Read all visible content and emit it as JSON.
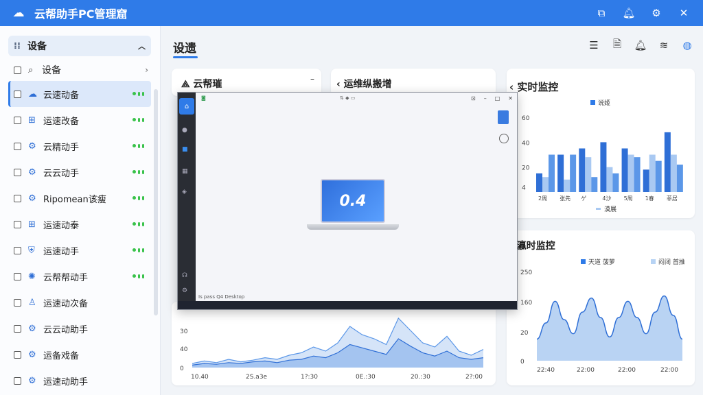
{
  "app": {
    "title": "云帮助手PC管理窟",
    "logo_icon": "cloud-logo-icon"
  },
  "titlebar_icons": [
    "screen-share-icon",
    "bell-icon",
    "gear-icon",
    "close-icon"
  ],
  "sidebar": {
    "header": "设备",
    "search": "设备",
    "items": [
      {
        "label": "云速动备",
        "icon": "cloud-icon",
        "active": true
      },
      {
        "label": "运速改备",
        "icon": "windows-icon"
      },
      {
        "label": "云精动手",
        "icon": "gear-icon"
      },
      {
        "label": "云云动手",
        "icon": "gear-icon"
      },
      {
        "label": "Ripomean该瘦",
        "icon": "gear-icon"
      },
      {
        "label": "运速动泰",
        "icon": "windows-icon"
      },
      {
        "label": "运速动手",
        "icon": "shield-icon"
      },
      {
        "label": "云帮帮动手",
        "icon": "settings-icon"
      },
      {
        "label": "运速动次备",
        "icon": "user-icon"
      },
      {
        "label": "云云动助手",
        "icon": "gear-icon"
      },
      {
        "label": "运备戏备",
        "icon": "gear-icon"
      },
      {
        "label": "运速动助手",
        "icon": "gear-icon"
      }
    ]
  },
  "main": {
    "title": "设遗",
    "tools": [
      "menu-icon",
      "document-icon",
      "bell-icon",
      "layers-icon",
      "globe-icon"
    ]
  },
  "cards": {
    "card1_title": "云帮璀",
    "card2_title": "运维纵搬增",
    "realtime_title": "实时监控",
    "realtime2_title": "瀛时监控"
  },
  "remote": {
    "status": "Is pass Q4 Desktop",
    "screen_text": "0.4"
  },
  "chart_data": [
    {
      "type": "bar",
      "title": "实时监控",
      "legend": [
        "说姬"
      ],
      "categories": [
        "2周",
        "张先",
        "ゲ",
        "4沙",
        "5周",
        "1春",
        "菲居"
      ],
      "yticks": [
        4,
        20,
        40,
        60
      ],
      "series": [
        {
          "values": [
            15,
            30,
            35,
            40,
            35,
            18,
            48
          ]
        },
        {
          "values": [
            12,
            10,
            28,
            20,
            30,
            30,
            30
          ]
        },
        {
          "values": [
            30,
            30,
            12,
            15,
            28,
            25,
            22
          ]
        }
      ],
      "bottom_legend": "漠展",
      "ylim": [
        0,
        65
      ]
    },
    {
      "type": "area",
      "legend": [
        "天道 菠萝",
        "闷闭 首推"
      ],
      "xticks": [
        "22:40",
        "22:00",
        "22:00",
        "22:00"
      ],
      "yticks": [
        "0",
        "20",
        "160",
        "250"
      ],
      "values": [
        20,
        35,
        55,
        38,
        25,
        45,
        58,
        40,
        22,
        40,
        55,
        40,
        25,
        45,
        60,
        42,
        20
      ],
      "ylim": [
        0,
        80
      ]
    },
    {
      "type": "area",
      "xticks": [
        "10.40",
        "2S.a3e",
        "1?:30",
        "0E.:30",
        "20.:30",
        "2?:00"
      ],
      "yticks": [
        "0",
        "40",
        "30"
      ],
      "series": [
        {
          "values": [
            5,
            8,
            6,
            10,
            7,
            9,
            12,
            10,
            15,
            18,
            25,
            20,
            30,
            50,
            40,
            35,
            28,
            60,
            45,
            30,
            25,
            38,
            20,
            15,
            22
          ]
        },
        {
          "values": [
            3,
            5,
            4,
            6,
            5,
            7,
            8,
            6,
            9,
            10,
            14,
            12,
            18,
            28,
            24,
            20,
            16,
            35,
            26,
            18,
            14,
            20,
            12,
            10,
            12
          ]
        }
      ],
      "ylim": [
        0,
        70
      ]
    }
  ]
}
